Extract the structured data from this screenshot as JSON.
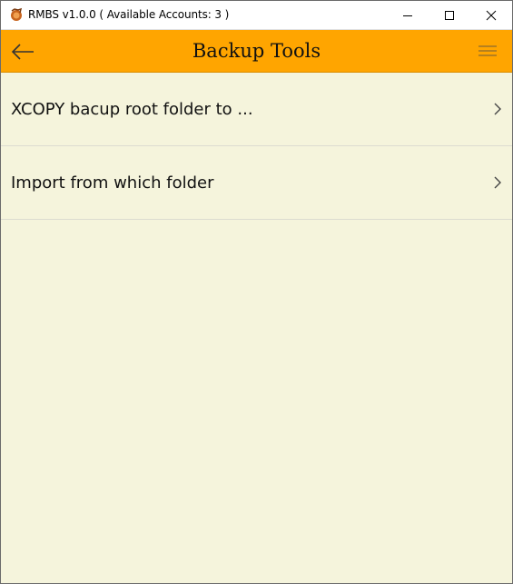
{
  "window": {
    "title": "RMBS v1.0.0 ( Available Accounts: 3 )"
  },
  "appbar": {
    "title": "Backup Tools",
    "back_icon": "arrow-left-icon",
    "menu_icon": "hamburger-menu-icon",
    "accent_color": "#ffa500"
  },
  "list": {
    "items": [
      {
        "label": "XCOPY bacup root folder to ...",
        "icon": "chevron-right-icon"
      },
      {
        "label": "Import from which folder",
        "icon": "chevron-right-icon"
      }
    ]
  },
  "colors": {
    "background": "#f5f4dc",
    "appbar": "#ffa500"
  }
}
